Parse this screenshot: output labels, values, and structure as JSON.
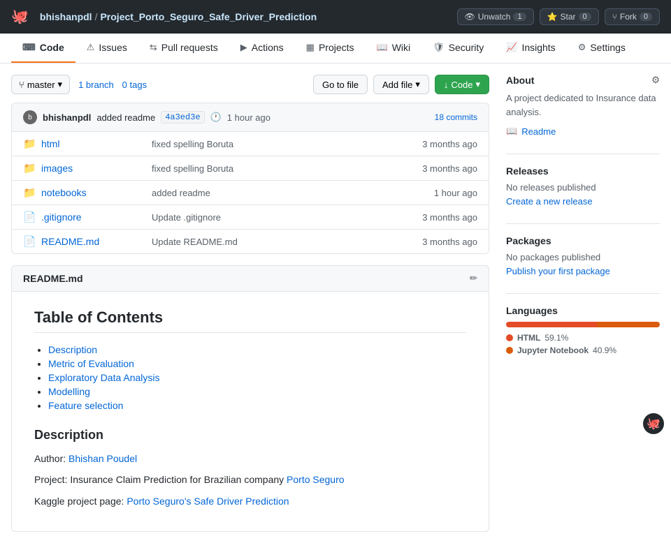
{
  "topBar": {
    "logoIcon": "🐙",
    "owner": "bhishanpdl",
    "separator": "/",
    "repoName": "Project_Porto_Seguro_Safe_Driver_Prediction",
    "watchLabel": "Unwatch",
    "watchCount": "1",
    "starLabel": "Star",
    "starCount": "0",
    "forkLabel": "Fork",
    "forkCount": "0"
  },
  "repoNav": {
    "items": [
      {
        "id": "code",
        "icon": "⌨",
        "label": "Code",
        "active": true
      },
      {
        "id": "issues",
        "icon": "⚠",
        "label": "Issues"
      },
      {
        "id": "pull-requests",
        "icon": "⇆",
        "label": "Pull requests"
      },
      {
        "id": "actions",
        "icon": "▶",
        "label": "Actions"
      },
      {
        "id": "projects",
        "icon": "▦",
        "label": "Projects"
      },
      {
        "id": "wiki",
        "icon": "📖",
        "label": "Wiki"
      },
      {
        "id": "security",
        "icon": "🛡",
        "label": "Security"
      },
      {
        "id": "insights",
        "icon": "📈",
        "label": "Insights"
      },
      {
        "id": "settings",
        "icon": "⚙",
        "label": "Settings"
      }
    ]
  },
  "branchBar": {
    "branchIcon": "⑂",
    "branchName": "master",
    "branchCount": "1 branch",
    "tagCount": "0 tags",
    "gotoFileLabel": "Go to file",
    "addFileLabel": "Add file",
    "addFileIcon": "▾",
    "codeLabel": "Code",
    "codeIcon": "↓",
    "codeDropIcon": "▾"
  },
  "commitBar": {
    "avatarText": "b",
    "username": "bhishanpdl",
    "message": "added readme",
    "hash": "4a3ed3e",
    "timeText": "1 hour ago",
    "clockIcon": "🕐",
    "commitsLink": "18 commits"
  },
  "files": [
    {
      "type": "folder",
      "name": "html",
      "commit": "fixed spelling Boruta",
      "time": "3 months ago"
    },
    {
      "type": "folder",
      "name": "images",
      "commit": "fixed spelling Boruta",
      "time": "3 months ago"
    },
    {
      "type": "folder",
      "name": "notebooks",
      "commit": "added readme",
      "time": "1 hour ago"
    },
    {
      "type": "file",
      "name": ".gitignore",
      "commit": "Update .gitignore",
      "time": "3 months ago"
    },
    {
      "type": "file",
      "name": "README.md",
      "commit": "Update README.md",
      "time": "3 months ago"
    }
  ],
  "readme": {
    "title": "README.md",
    "editIcon": "✏",
    "tableOfContentsHeading": "Table of Contents",
    "tocItems": [
      {
        "label": "Description",
        "href": "#description"
      },
      {
        "label": "Metric of Evaluation",
        "href": "#metric-of-evaluation"
      },
      {
        "label": "Exploratory Data Analysis",
        "href": "#exploratory-data-analysis"
      },
      {
        "label": "Modelling",
        "href": "#modelling"
      },
      {
        "label": "Feature selection",
        "href": "#feature-selection"
      }
    ],
    "descriptionHeading": "Description",
    "authorLabel": "Author:",
    "authorName": "Bhishan Poudel",
    "projectLabel": "Project: Insurance Claim Prediction for Brazilian company",
    "projectLink": "Porto Seguro",
    "kaggleLabel": "Kaggle project page:",
    "kaggleLink": "Porto Seguro's Safe Driver Prediction"
  },
  "sidebar": {
    "aboutHeading": "About",
    "gearIcon": "⚙",
    "aboutText": "A project dedicated to Insurance data analysis.",
    "readmeLabel": "Readme",
    "bookIcon": "📖",
    "releasesHeading": "Releases",
    "noReleasesText": "No releases published",
    "createReleaseLink": "Create a new release",
    "packagesHeading": "Packages",
    "noPackagesText": "No packages published",
    "publishPackageLink": "Publish your first package",
    "languagesHeading": "Languages",
    "languages": [
      {
        "name": "HTML",
        "percent": "59.1%",
        "color": "#e34c26",
        "width": 59.1
      },
      {
        "name": "Jupyter Notebook",
        "percent": "40.9%",
        "color": "#da5b0b",
        "width": 40.9
      }
    ]
  }
}
